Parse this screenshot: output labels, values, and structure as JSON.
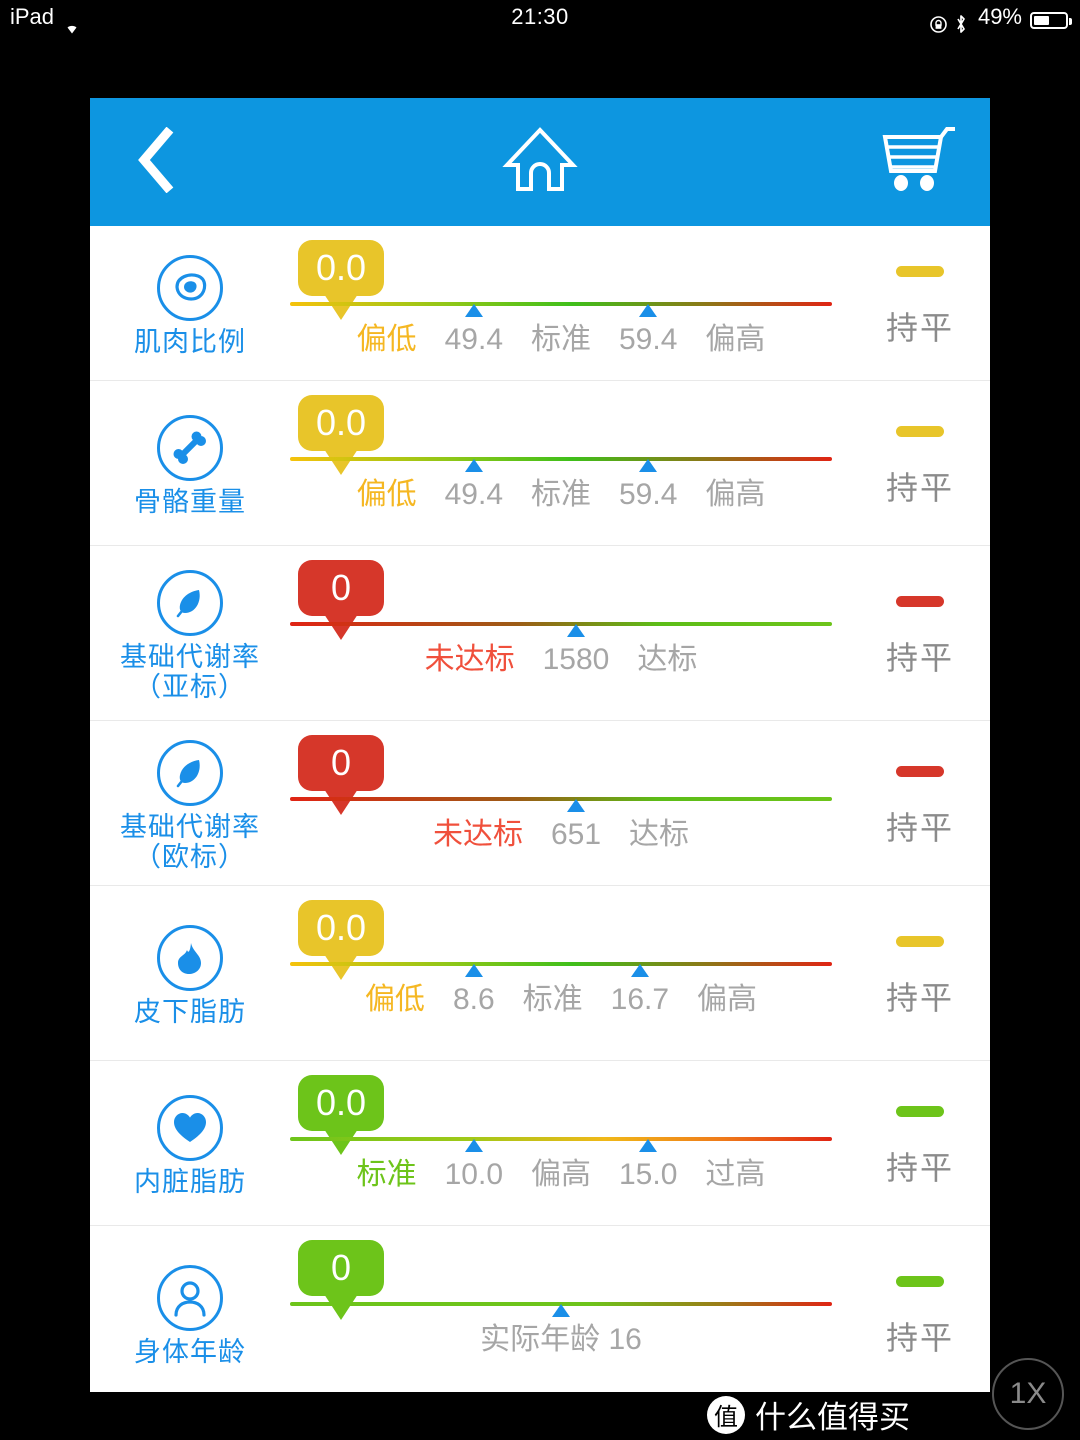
{
  "statusbar": {
    "carrier": "iPad",
    "wifi_icon": "wifi-icon",
    "time": "21:30",
    "rotation_lock_icon": "rotation-lock-icon",
    "bluetooth_icon": "bluetooth-icon",
    "battery_percent": "49%",
    "battery_icon": "battery-icon"
  },
  "navbar": {
    "back_icon": "chevron-left-icon",
    "home_icon": "home-icon",
    "cart_icon": "shopping-cart-icon",
    "bg_color": "#0d96e0"
  },
  "colors": {
    "accent_blue": "#1a8fe8",
    "yellow": "#e8c52a",
    "red": "#d6372a",
    "green": "#6dc41a",
    "gray_text": "#a6a6a6"
  },
  "rows": [
    {
      "name": "肌肉比例",
      "icon": "meat-icon",
      "value": "0.0",
      "bubble_color": "#e8c52a",
      "bar_gradient": "linear-gradient(90deg,#f5c20c 0%,#8dc718 30%,#3fbf1a 52%,#8a7a18 76%,#e02414 100%)",
      "segments": [
        {
          "text": "偏低",
          "type": "label",
          "state": "active-low"
        },
        {
          "text": "49.4",
          "type": "tick",
          "state": ""
        },
        {
          "text": "标准",
          "type": "label",
          "state": ""
        },
        {
          "text": "59.4",
          "type": "tick",
          "state": ""
        },
        {
          "text": "偏高",
          "type": "label",
          "state": ""
        }
      ],
      "trend": "持平",
      "trend_color": "#e8c52a"
    },
    {
      "name": "骨骼重量",
      "icon": "bone-icon",
      "value": "0.0",
      "bubble_color": "#e8c52a",
      "bar_gradient": "linear-gradient(90deg,#f5c20c 0%,#8dc718 30%,#3fbf1a 52%,#8a7a18 76%,#e02414 100%)",
      "segments": [
        {
          "text": "偏低",
          "type": "label",
          "state": "active-low"
        },
        {
          "text": "49.4",
          "type": "tick",
          "state": ""
        },
        {
          "text": "标准",
          "type": "label",
          "state": ""
        },
        {
          "text": "59.4",
          "type": "tick",
          "state": ""
        },
        {
          "text": "偏高",
          "type": "label",
          "state": ""
        }
      ],
      "trend": "持平",
      "trend_color": "#e8c52a"
    },
    {
      "name": "基础代谢率",
      "name2": "（亚标）",
      "icon": "leaf-icon",
      "value": "0",
      "bubble_color": "#d6372a",
      "bar_gradient": "linear-gradient(90deg,#e02414 0%,#9c5c16 42%,#5cbd17 68%,#6dc41a 100%)",
      "segments": [
        {
          "text": "未达标",
          "type": "label",
          "state": "active-red"
        },
        {
          "text": "1580",
          "type": "tick",
          "state": ""
        },
        {
          "text": "达标",
          "type": "label",
          "state": ""
        }
      ],
      "trend": "持平",
      "trend_color": "#d6372a"
    },
    {
      "name": "基础代谢率",
      "name2": "（欧标）",
      "icon": "leaf-icon",
      "value": "0",
      "bubble_color": "#d6372a",
      "bar_gradient": "linear-gradient(90deg,#e02414 0%,#9c5c16 42%,#5cbd17 68%,#6dc41a 100%)",
      "segments": [
        {
          "text": "未达标",
          "type": "label",
          "state": "active-red"
        },
        {
          "text": "651",
          "type": "tick",
          "state": ""
        },
        {
          "text": "达标",
          "type": "label",
          "state": ""
        }
      ],
      "trend": "持平",
      "trend_color": "#d6372a"
    },
    {
      "name": "皮下脂肪",
      "icon": "flame-drop-icon",
      "value": "0.0",
      "bubble_color": "#e8c52a",
      "bar_gradient": "linear-gradient(90deg,#f5c20c 0%,#8dc718 30%,#3fbf1a 52%,#8a7a18 76%,#e02414 100%)",
      "segments": [
        {
          "text": "偏低",
          "type": "label",
          "state": "active-low"
        },
        {
          "text": "8.6",
          "type": "tick",
          "state": ""
        },
        {
          "text": "标准",
          "type": "label",
          "state": ""
        },
        {
          "text": "16.7",
          "type": "tick",
          "state": ""
        },
        {
          "text": "偏高",
          "type": "label",
          "state": ""
        }
      ],
      "trend": "持平",
      "trend_color": "#e8c52a"
    },
    {
      "name": "内脏脂肪",
      "icon": "heart-icon",
      "value": "0.0",
      "bubble_color": "#6dc41a",
      "bar_gradient": "linear-gradient(90deg,#6dc41a 0%,#9ec918 32%,#f0b818 58%,#ef7a1a 80%,#e02414 100%)",
      "segments": [
        {
          "text": "标准",
          "type": "label",
          "state": "active-green"
        },
        {
          "text": "10.0",
          "type": "tick",
          "state": ""
        },
        {
          "text": "偏高",
          "type": "label",
          "state": ""
        },
        {
          "text": "15.0",
          "type": "tick",
          "state": ""
        },
        {
          "text": "过高",
          "type": "label",
          "state": ""
        }
      ],
      "trend": "持平",
      "trend_color": "#6dc41a"
    },
    {
      "name": "身体年龄",
      "icon": "person-icon",
      "value": "0",
      "bubble_color": "#6dc41a",
      "bar_gradient": "linear-gradient(90deg,#6dc41a 0%,#6dc41a 55%,#9c7a18 80%,#e02414 100%)",
      "single": {
        "text": "实际年龄 16"
      },
      "trend": "持平",
      "trend_color": "#6dc41a"
    }
  ],
  "watermark": {
    "badge": "值",
    "text": "什么值得买"
  },
  "zoom_badge": "1X"
}
